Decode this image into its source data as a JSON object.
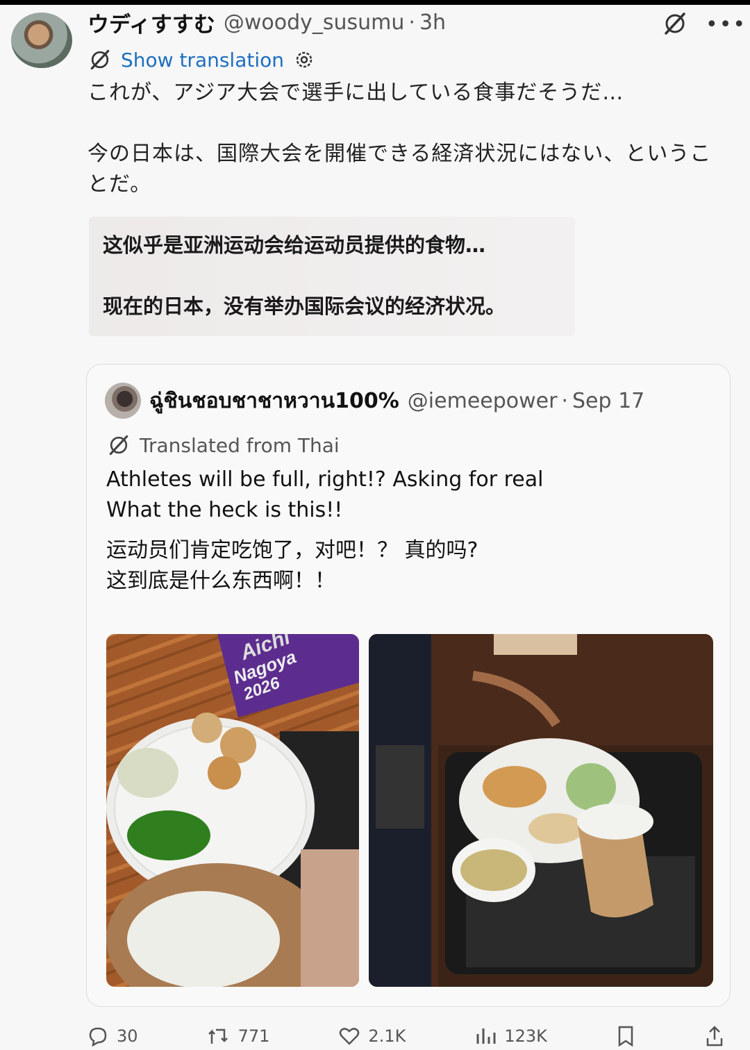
{
  "post": {
    "display_name": "ウディすすむ",
    "handle": "@woody_susumu",
    "separator": "·",
    "time": "3h",
    "show_translation_label": "Show translation",
    "text_line_1": "これが、アジア大会で選手に出している食事だそうだ…",
    "text_line_2": "今の日本は、国際大会を開催できる経済状況にはない、ということだ。",
    "translation_block": {
      "line_1": "这似乎是亚洲运动会给运动员提供的食物…",
      "line_2": "现在的日本，没有举办国际会议的经济状况。"
    }
  },
  "quoted": {
    "display_name": "ฉู่ชินชอบชาชาหวาน100%",
    "handle": "@iemeepower",
    "separator": "·",
    "date": "Sep 17",
    "translated_from_label": "Translated from Thai",
    "text_en_1": "Athletes will be full, right!? Asking for real",
    "text_en_2": "What the heck is this!!",
    "text_cn_1": "运动员们肯定吃饱了，对吧！？ 真的吗?",
    "text_cn_2": "这到底是什么东西啊！！",
    "photo_1_banner": [
      "Aichi",
      "Nagoya",
      "2026"
    ]
  },
  "actions": {
    "reply_count": "30",
    "repost_count": "771",
    "like_count": "2.1K",
    "views_count": "123K"
  },
  "icons": {
    "grok": "grok-slash-icon",
    "more": "more-dots-icon",
    "settings": "gear-icon"
  },
  "colors": {
    "link_blue": "#1d6fbf",
    "background": "#f7f7f7"
  }
}
